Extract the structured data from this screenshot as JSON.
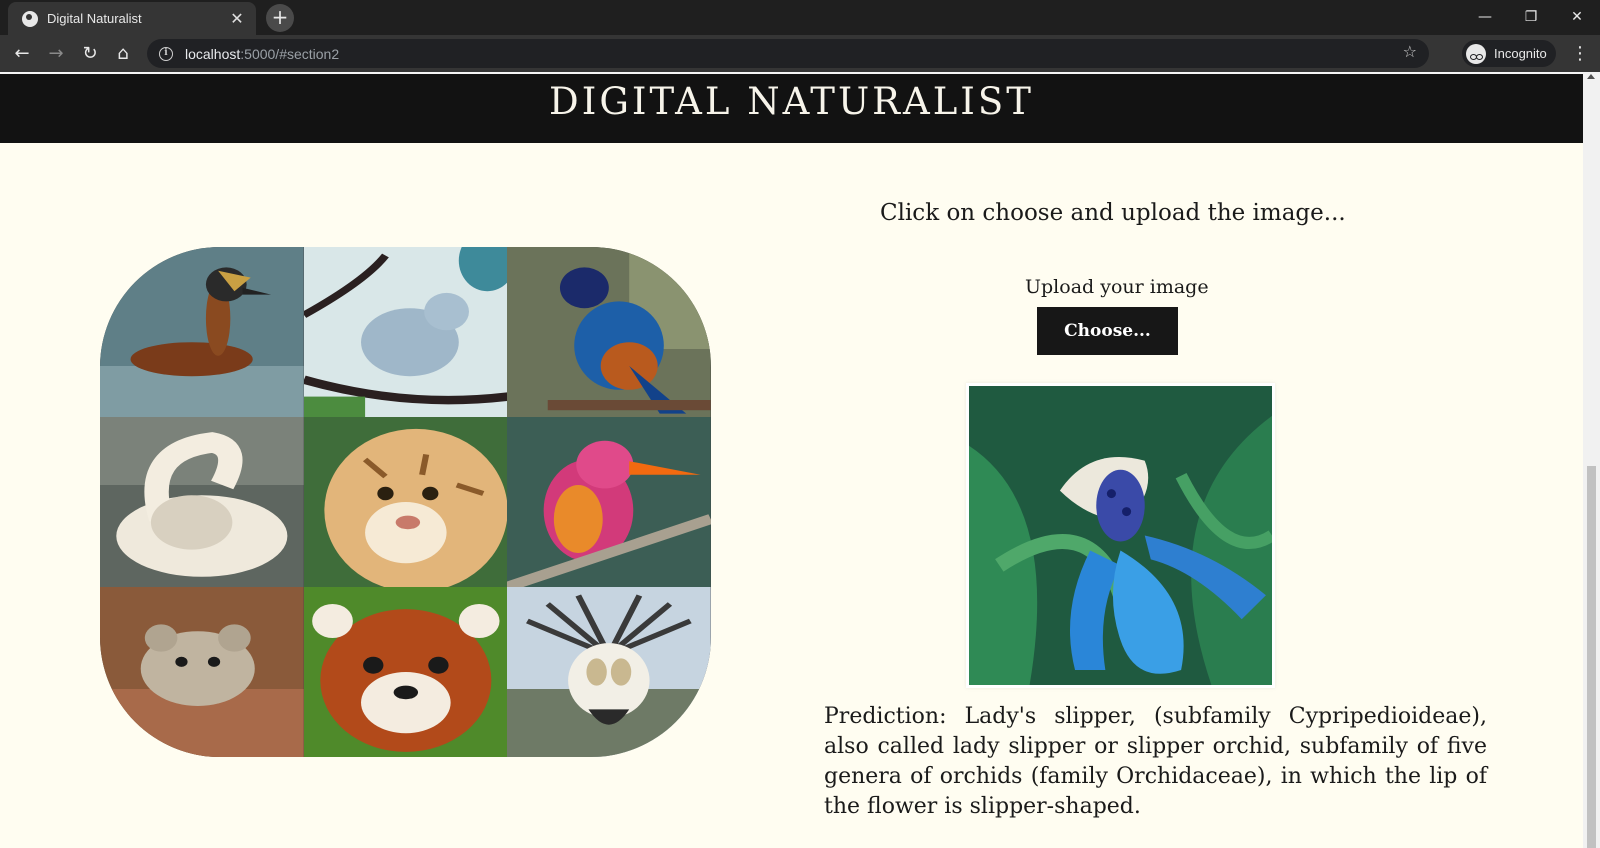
{
  "browser": {
    "tab_title": "Digital Naturalist",
    "url_host": "localhost",
    "url_rest": ":5000/#section2",
    "profile_label": "Incognito"
  },
  "page": {
    "site_title": "DIGITAL NATURALIST",
    "upload_prompt": "Click on choose and upload the image...",
    "upload_label": "Upload your image",
    "choose_label": "Choose...",
    "prediction": "Prediction: Lady's slipper, (subfamily Cypripedioideae), also called lady slipper or slipper orchid, subfamily of five genera of orchids (family Orchidaceae), in which the lip of the flower is slipper-shaped."
  },
  "collage": {
    "photos": [
      "grebe",
      "blue-bird",
      "starling",
      "swan",
      "tiger",
      "kingfisher",
      "pika",
      "red-panda",
      "sage-grouse"
    ]
  },
  "colors": {
    "page_background": "#fffdf1",
    "header_background": "#121212",
    "button_background": "#171717"
  }
}
